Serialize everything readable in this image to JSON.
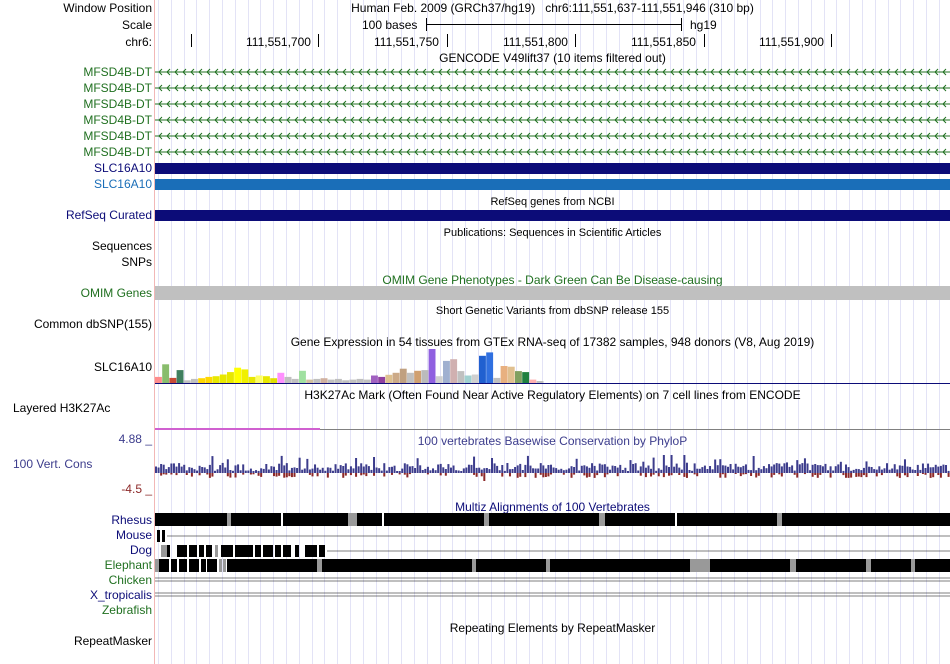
{
  "header": {
    "window_position_label": "Window Position",
    "scale_label": "Scale",
    "chrom_label": "chr6:",
    "assembly_title": "Human Feb. 2009 (GRCh37/hg19)",
    "coords": "chr6:111,551,637-111,551,946 (310 bp)",
    "scale_text": "100 bases",
    "db": "hg19",
    "ruler_positions": [
      "111,551,700",
      "111,551,750",
      "111,551,800",
      "111,551,850",
      "111,551,900"
    ]
  },
  "tracks": {
    "gencode": {
      "title": "GENCODE V49lift37 (10 items filtered out)",
      "items": [
        "MFSD4B-DT",
        "MFSD4B-DT",
        "MFSD4B-DT",
        "MFSD4B-DT",
        "MFSD4B-DT",
        "MFSD4B-DT",
        "SLC16A10",
        "SLC16A10"
      ]
    },
    "refseq": {
      "title": "RefSeq genes from NCBI",
      "label": "RefSeq Curated"
    },
    "publications": {
      "title": "Publications: Sequences in Scientific Articles",
      "label1": "Sequences",
      "label2": "SNPs"
    },
    "omim": {
      "title": "OMIM Gene Phenotypes - Dark Green Can Be Disease-causing",
      "label": "OMIM Genes"
    },
    "dbsnp": {
      "title": "Short Genetic Variants from dbSNP release 155",
      "label": "Common dbSNP(155)"
    },
    "gtex": {
      "title": "Gene Expression in 54 tissues from GTEx RNA-seq of 17382 samples, 948 donors (V8, Aug 2019)",
      "label": "SLC16A10"
    },
    "h3k27ac": {
      "title": "H3K27Ac Mark (Often Found Near Active Regulatory Elements) on 7 cell lines from ENCODE",
      "label": "Layered H3K27Ac"
    },
    "conservation": {
      "title": "100 vertebrates Basewise Conservation by PhyloP",
      "label": "100 Vert. Cons",
      "max_label": "4.88 _",
      "min_label": "-4.5 _"
    },
    "multiz": {
      "title": "Multiz Alignments of 100 Vertebrates",
      "species": [
        "Rhesus",
        "Mouse",
        "Dog",
        "Elephant",
        "Chicken",
        "X_tropicalis",
        "Zebrafish"
      ]
    },
    "repeatmasker": {
      "title": "Repeating Elements by RepeatMasker",
      "label": "RepeatMasker"
    }
  },
  "colors": {
    "gencode_green": "#207020",
    "slc_dark": "#0c0c78",
    "slc_light": "#1a6eb8",
    "omim_gray": "#c0c0c0",
    "cons_blue": "#3c3c8c",
    "cons_red": "#8c2828",
    "divider": "#f2b7b7"
  },
  "gtex_values": [
    0.18,
    0.55,
    0.15,
    0.38,
    0.08,
    0.12,
    0.14,
    0.18,
    0.2,
    0.25,
    0.32,
    0.45,
    0.4,
    0.18,
    0.22,
    0.2,
    0.14,
    0.3,
    0.18,
    0.12,
    0.36,
    0.1,
    0.12,
    0.14,
    0.1,
    0.12,
    0.08,
    0.1,
    0.12,
    0.1,
    0.22,
    0.18,
    0.24,
    0.3,
    0.42,
    0.3,
    0.36,
    0.38,
    1.0,
    0.2,
    0.65,
    0.7,
    0.35,
    0.22,
    0.25,
    0.8,
    0.9,
    0.15,
    0.5,
    0.48,
    0.35,
    0.32,
    0.1,
    0.06
  ],
  "gtex_colors": [
    "#ff8c8c",
    "#89bd6c",
    "#c84b37",
    "#3f7f5f",
    "#c0c0c0",
    "#c0c0c0",
    "#ffd700",
    "#ffd700",
    "#e8e800",
    "#e8e800",
    "#e8e800",
    "#ffff00",
    "#f0f000",
    "#e8e800",
    "#ffff66",
    "#e8e800",
    "#e0e000",
    "#ff90ff",
    "#c0c0c0",
    "#c0c0c0",
    "#a0e0a0",
    "#d0c0a0",
    "#c0c0c0",
    "#d0b0a0",
    "#c0c0c0",
    "#c0c0c0",
    "#c0c0c0",
    "#c0c0c0",
    "#c0c0c0",
    "#c0c0c0",
    "#a060c0",
    "#9040a0",
    "#ddc090",
    "#ccaa88",
    "#c0a080",
    "#c0c0c0",
    "#d0a070",
    "#bbbbbb",
    "#9060e0",
    "#d0d0d0",
    "#a0b0d0",
    "#d0b0b0",
    "#c0c0c0",
    "#a0d0d0",
    "#d0d0d0",
    "#2060d0",
    "#3070e0",
    "#c0c0c0",
    "#e8b080",
    "#e0c090",
    "#80a060",
    "#208040",
    "#ffb0b0",
    "#c0c0c0"
  ]
}
